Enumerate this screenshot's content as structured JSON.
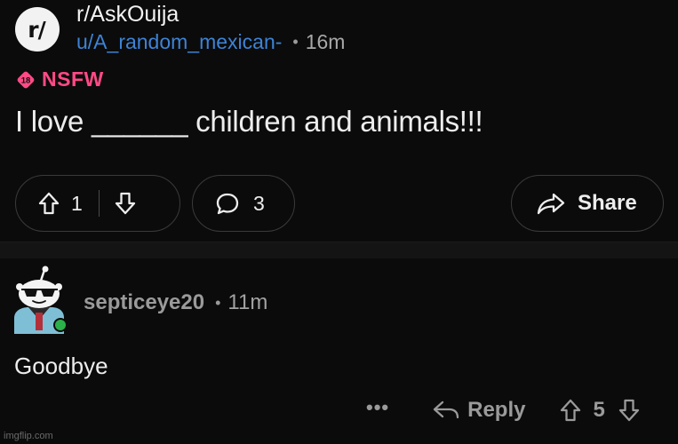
{
  "post": {
    "subreddit_avatar": "r/",
    "subreddit": "r/AskOuija",
    "author": "u/A_random_mexican-",
    "separator": "•",
    "time": "16m",
    "nsfw_badge_number": "18",
    "nsfw_label": "NSFW",
    "title": "I love ______ children and animals!!!",
    "upvotes": "1",
    "comments": "3",
    "share_label": "Share"
  },
  "comment": {
    "author": "septiceye20",
    "separator": "•",
    "time": "11m",
    "body": "Goodbye",
    "more_label": "•••",
    "reply_label": "Reply",
    "votes": "5"
  },
  "watermark": "imgflip.com",
  "colors": {
    "background": "#0b0b0b",
    "author_link": "#3d83d6",
    "nsfw": "#ff4a86",
    "online_dot": "#2bb04a",
    "avatar_bg": "#7fbfd6"
  },
  "icons": {
    "upvote": "arrow-up-outline-icon",
    "downvote": "arrow-down-outline-icon",
    "comment": "speech-bubble-icon",
    "share": "share-arrow-icon",
    "reply": "reply-arrow-icon",
    "more": "ellipsis-icon"
  }
}
